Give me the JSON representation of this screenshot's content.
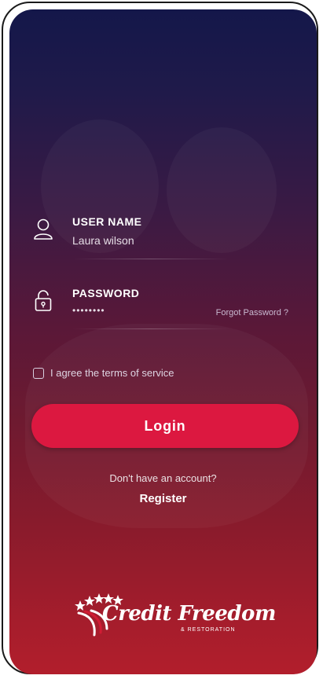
{
  "form": {
    "username_label": "USER NAME",
    "username_value": "Laura wilson",
    "password_label": "PASSWORD",
    "password_value": "••••••••",
    "forgot_link": "Forgot Password ?",
    "agree_text": "I agree the terms of service",
    "agree_checked": false,
    "login_button": "Login"
  },
  "footer": {
    "no_account_text": "Don't have an account?",
    "register_link": "Register"
  },
  "logo": {
    "primary": "Credit Freedom",
    "secondary": "& Restoration"
  },
  "icons": {
    "user": "user-icon",
    "lock": "lock-icon",
    "checkbox": "checkbox-icon"
  },
  "colors": {
    "gradient_top": "#14174a",
    "gradient_bottom": "#b21e2c",
    "button": "#dc1840"
  }
}
